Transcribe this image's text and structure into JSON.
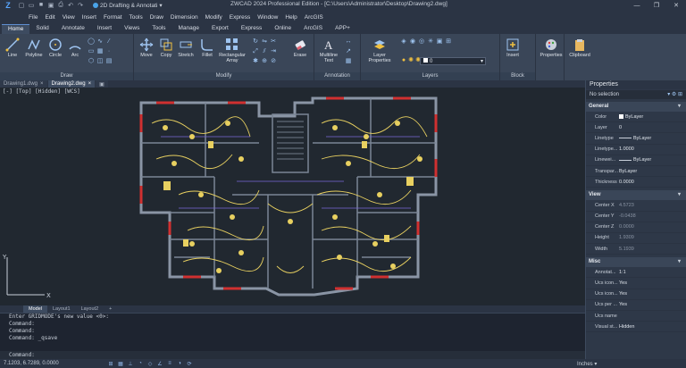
{
  "titlebar": {
    "workspace": "2D Drafting & Annotati",
    "title": "ZWCAD 2024 Professional Edition - [C:\\Users\\Administrator\\Desktop\\Drawing2.dwg]"
  },
  "menu": [
    "File",
    "Edit",
    "View",
    "Insert",
    "Format",
    "Tools",
    "Draw",
    "Dimension",
    "Modify",
    "Express",
    "Window",
    "Help",
    "ArcGIS"
  ],
  "ribbon_tabs": [
    "Home",
    "Solid",
    "Annotate",
    "Insert",
    "Views",
    "Tools",
    "Manage",
    "Export",
    "Express",
    "Online",
    "ArcGIS",
    "APP+"
  ],
  "ribbon": {
    "draw_label": "Draw",
    "modify_label": "Modify",
    "annotation_label": "Annotation",
    "layers_label": "Layers",
    "block_label": "Block",
    "tools": {
      "line": "Line",
      "polyline": "Polyline",
      "circle": "Circle",
      "arc": "Arc",
      "move": "Move",
      "copy": "Copy",
      "stretch": "Stretch",
      "fillet": "Fillet",
      "rect_array": "Rectangular Array",
      "erase": "Erase",
      "mtext": "Multiline Text",
      "layer_props": "Layer Properties",
      "insert": "Insert",
      "properties": "Properties",
      "clipboard": "Clipboard"
    },
    "layer_value": "0"
  },
  "doc_tabs": [
    {
      "label": "Drawing1.dwg",
      "active": false
    },
    {
      "label": "Drawing2.dwg",
      "active": true
    }
  ],
  "viewport_label": "[-] [Top] [Hidden] [WCS]",
  "layout_tabs": [
    "Model",
    "Layout1",
    "Layout2",
    "+"
  ],
  "command_history": [
    "Enter GRIDMODE's new value <0>:",
    "Command:",
    "Command:",
    "Command: _qsave"
  ],
  "command_prompt": "Command:",
  "status": {
    "coords": "7.1203, 6.7289, 0.0000",
    "units": "Inches"
  },
  "properties": {
    "title": "Properties",
    "selection": "No selection",
    "sections": [
      {
        "name": "General",
        "rows": [
          {
            "key": "Color",
            "value": "ByLayer",
            "kind": "color"
          },
          {
            "key": "Layer",
            "value": "0",
            "kind": "text"
          },
          {
            "key": "Linetype",
            "value": "ByLayer",
            "kind": "line"
          },
          {
            "key": "Linetype...",
            "value": "1.0000",
            "kind": "text"
          },
          {
            "key": "Linewei...",
            "value": "ByLayer",
            "kind": "line"
          },
          {
            "key": "Transpar...",
            "value": "ByLayer",
            "kind": "text"
          },
          {
            "key": "Thickness",
            "value": "0.0000",
            "kind": "text"
          }
        ]
      },
      {
        "name": "View",
        "rows": [
          {
            "key": "Center X",
            "value": "4.5723",
            "kind": "dim"
          },
          {
            "key": "Center Y",
            "value": "-0.0438",
            "kind": "dim"
          },
          {
            "key": "Center Z",
            "value": "0.0000",
            "kind": "dim"
          },
          {
            "key": "Height",
            "value": "1.9309",
            "kind": "dim"
          },
          {
            "key": "Width",
            "value": "5.1939",
            "kind": "dim"
          }
        ]
      },
      {
        "name": "Misc",
        "rows": [
          {
            "key": "Annotat...",
            "value": "1:1",
            "kind": "text"
          },
          {
            "key": "Ucs icon...",
            "value": "Yes",
            "kind": "text"
          },
          {
            "key": "Ucs icon...",
            "value": "Yes",
            "kind": "text"
          },
          {
            "key": "Ucs per ...",
            "value": "Yes",
            "kind": "text"
          },
          {
            "key": "Ucs name",
            "value": "",
            "kind": "text"
          },
          {
            "key": "Visual st...",
            "value": "Hidden",
            "kind": "text"
          }
        ]
      }
    ]
  }
}
